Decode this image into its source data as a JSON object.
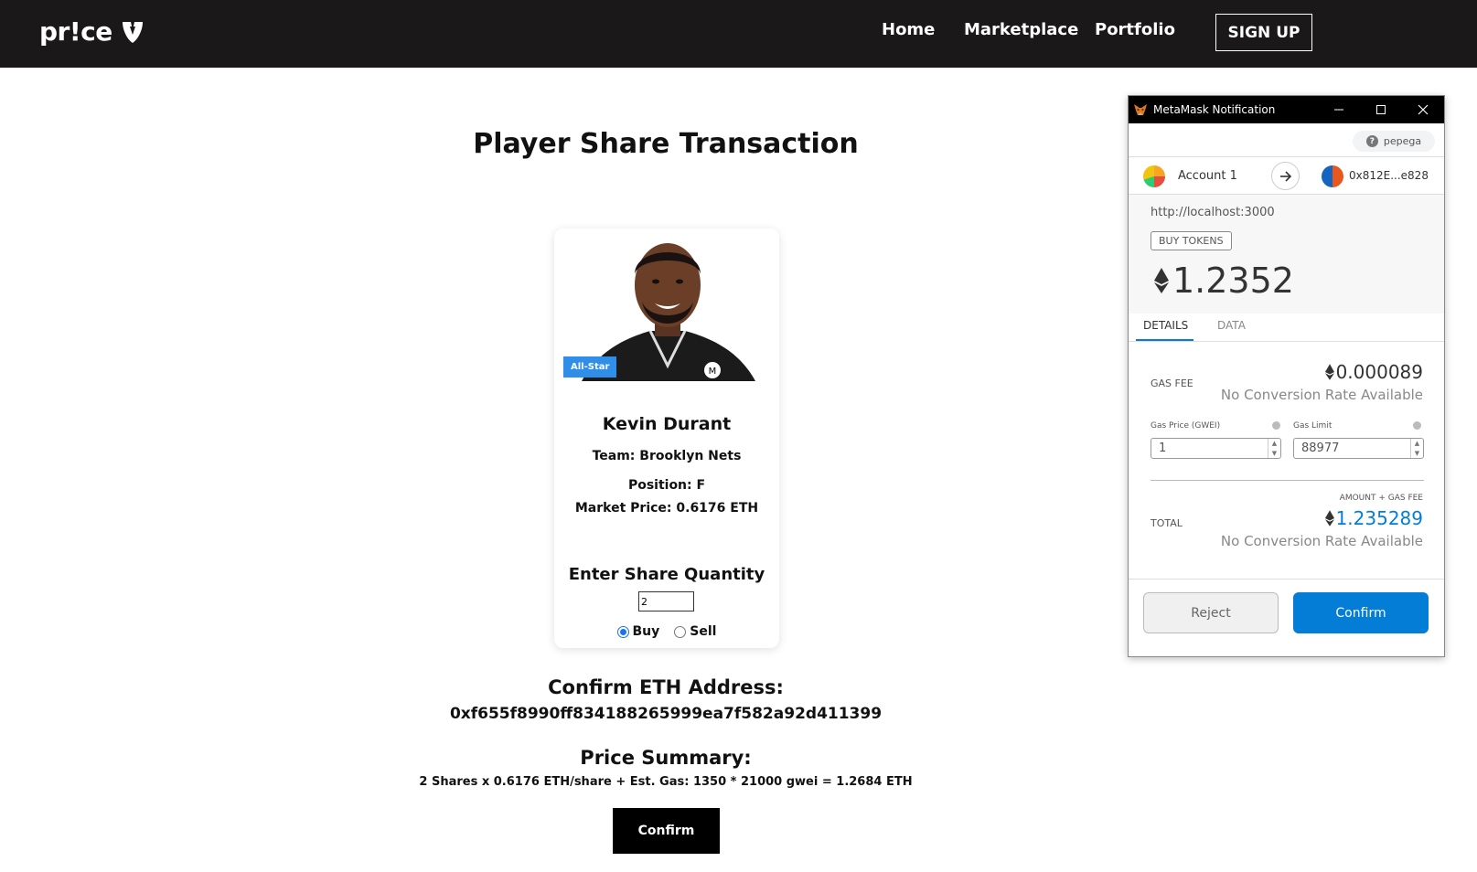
{
  "brand": {
    "logo_text": "pr!ce"
  },
  "nav": {
    "home": "Home",
    "marketplace": "Marketplace",
    "portfolio": "Portfolio",
    "signup": "SIGN UP"
  },
  "page": {
    "title": "Player Share Transaction"
  },
  "player": {
    "badge": "All-Star",
    "name": "Kevin Durant",
    "team": "Team: Brooklyn Nets",
    "position": "Position: F",
    "market_price": "Market Price: 0.6176 ETH"
  },
  "order": {
    "quantity_label": "Enter Share Quantity",
    "quantity_value": "2",
    "options": [
      {
        "label": "Buy",
        "selected": true
      },
      {
        "label": "Sell",
        "selected": false
      }
    ]
  },
  "confirm": {
    "address_title": "Confirm ETH Address:",
    "address": "0xf655f8990ff834188265999ea7f582a92d411399",
    "summary_title": "Price Summary:",
    "summary_detail": "2 Shares x 0.6176 ETH/share + Est. Gas: 1350 * 21000 gwei = 1.2684 ETH",
    "button": "Confirm"
  },
  "metamask": {
    "window_title": "MetaMask Notification",
    "network": "pepega",
    "from_account": "Account 1",
    "to_address": "0x812E...e828",
    "origin": "http://localhost:3000",
    "buy_tokens": "BUY TOKENS",
    "amount": "1.2352",
    "tabs": {
      "details": "DETAILS",
      "data": "DATA"
    },
    "gas_fee_label": "GAS FEE",
    "gas_fee_value": "0.000089",
    "no_conversion_1": "No Conversion Rate Available",
    "gas_price_label": "Gas Price (GWEI)",
    "gas_limit_label": "Gas Limit",
    "gas_price_value": "1",
    "gas_limit_value": "88977",
    "amount_plus_gas": "AMOUNT + GAS FEE",
    "total_label": "TOTAL",
    "total_value": "1.235289",
    "no_conversion_2": "No Conversion Rate Available",
    "reject": "Reject",
    "confirm": "Confirm",
    "accent_color": "#037dd6"
  }
}
